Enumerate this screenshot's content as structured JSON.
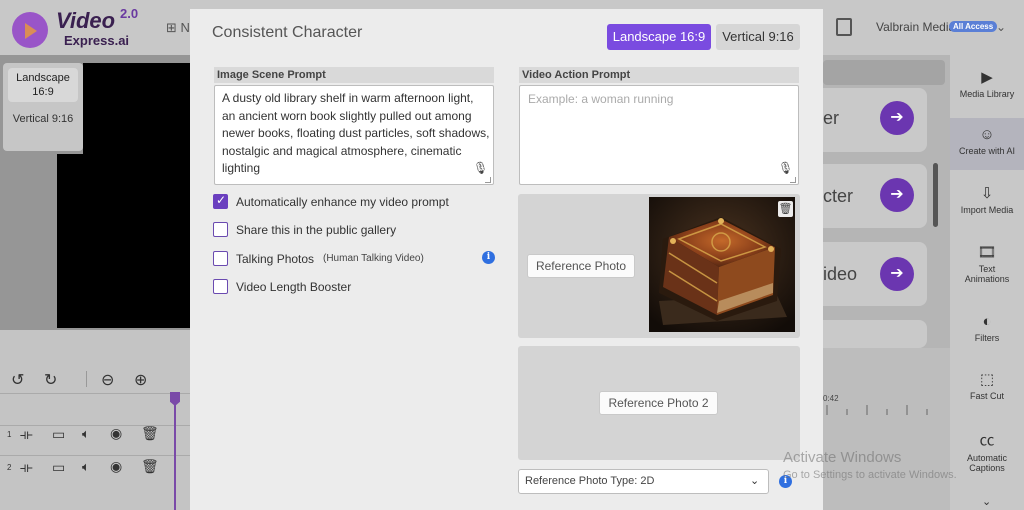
{
  "app": {
    "logo_word1": "Video",
    "logo_word2": "Express.ai",
    "logo_version": "2.0",
    "new_label": "N",
    "user_name": "Valbrain Media",
    "access_badge": "All Access"
  },
  "orientation_panel": {
    "landscape": "Landscape 16:9",
    "vertical": "Vertical 9:16"
  },
  "right_panel": {
    "card_texts": [
      "er",
      "cter",
      "ideo"
    ],
    "ruler_label": "0:42"
  },
  "sidebar": {
    "items": [
      {
        "label": "Media Library",
        "icon": "media-library-icon"
      },
      {
        "label": "Create with AI",
        "icon": "robot-icon"
      },
      {
        "label": "Import Media",
        "icon": "import-icon"
      },
      {
        "label": "Text Animations",
        "icon": "film-icon"
      },
      {
        "label": "Filters",
        "icon": "filter-icon"
      },
      {
        "label": "Fast Cut",
        "icon": "fast-cut-icon"
      },
      {
        "label": "Automatic Captions",
        "icon": "cc-icon"
      }
    ]
  },
  "timeline": {
    "track_numbers": [
      "1",
      "2"
    ]
  },
  "watermark": {
    "line1": "Activate Windows",
    "line2": "Go to Settings to activate Windows."
  },
  "modal": {
    "title": "Consistent Character",
    "aspect_landscape": "Landscape 16:9",
    "aspect_vertical": "Vertical 9:16",
    "scene_prompt_label": "Image Scene Prompt",
    "scene_prompt_value": "A dusty old library shelf in warm afternoon light, an ancient worn book slightly pulled out among newer books, floating dust particles, soft shadows, nostalgic and magical atmosphere, cinematic lighting",
    "action_prompt_label": "Video Action Prompt",
    "action_prompt_placeholder": "Example: a woman running",
    "checkboxes": [
      {
        "label": "Automatically enhance my video prompt",
        "checked": true
      },
      {
        "label": "Share this in the public gallery",
        "checked": false
      },
      {
        "label": "Talking Photos",
        "sub": "(Human Talking Video)",
        "checked": false
      },
      {
        "label": "Video Length Booster",
        "checked": false
      }
    ],
    "ref_photo_1": "Reference Photo",
    "ref_photo_2": "Reference Photo 2",
    "ref_type_select": "Reference Photo Type: 2D",
    "colors": {
      "accent": "#7a4be0",
      "info": "#2f6fe0"
    }
  }
}
